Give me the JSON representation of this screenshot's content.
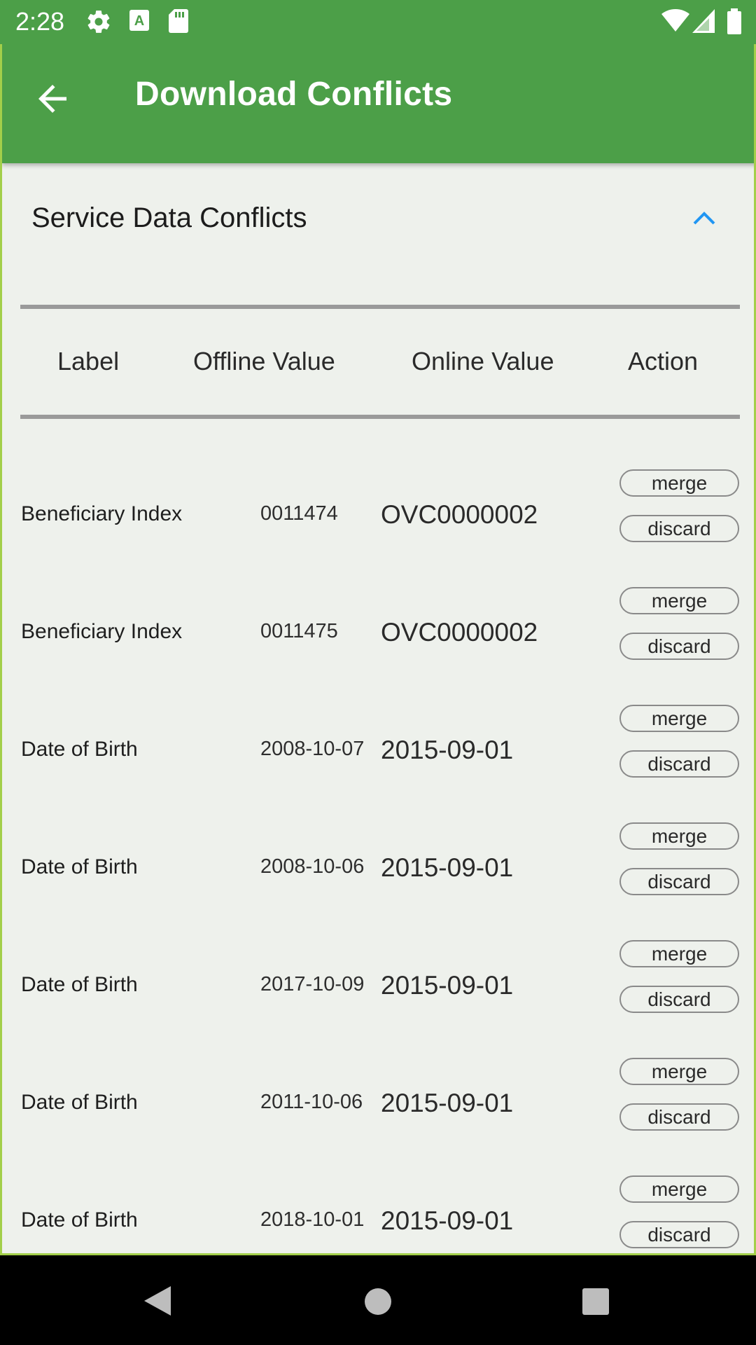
{
  "status_bar": {
    "time": "2:28",
    "icons": [
      "settings-gear-icon",
      "a-keyboard-icon",
      "sd-card-icon",
      "wifi-icon",
      "cellular-signal-icon",
      "battery-icon"
    ]
  },
  "app_bar": {
    "title": "Download Conflicts",
    "back_icon": "arrow-back-icon"
  },
  "section": {
    "title": "Service Data Conflicts",
    "toggle_icon": "chevron-up-icon",
    "accent_color": "#2196f3"
  },
  "table": {
    "headers": [
      "Label",
      "Offline Value",
      "Online Value",
      "Action"
    ],
    "rows": [
      {
        "label": "Beneficiary Index",
        "offline": "0011474",
        "online": "OVC0000002",
        "merge": "merge",
        "discard": "discard"
      },
      {
        "label": "Beneficiary Index",
        "offline": "0011475",
        "online": "OVC0000002",
        "merge": "merge",
        "discard": "discard"
      },
      {
        "label": "Date of Birth",
        "offline": "2008-10-07",
        "online": "2015-09-01",
        "merge": "merge",
        "discard": "discard"
      },
      {
        "label": "Date of Birth",
        "offline": "2008-10-06",
        "online": "2015-09-01",
        "merge": "merge",
        "discard": "discard"
      },
      {
        "label": "Date of Birth",
        "offline": "2017-10-09",
        "online": "2015-09-01",
        "merge": "merge",
        "discard": "discard"
      },
      {
        "label": "Date of Birth",
        "offline": "2011-10-06",
        "online": "2015-09-01",
        "merge": "merge",
        "discard": "discard"
      },
      {
        "label": "Date of Birth",
        "offline": "2018-10-01",
        "online": "2015-09-01",
        "merge": "merge",
        "discard": "discard"
      }
    ]
  },
  "nav_bar": {
    "icons": [
      "back-triangle-icon",
      "home-circle-icon",
      "recents-square-icon"
    ]
  },
  "colors": {
    "app_bar": "#4c9f48",
    "background": "#eef1ec",
    "divider": "#9a9a9a"
  }
}
